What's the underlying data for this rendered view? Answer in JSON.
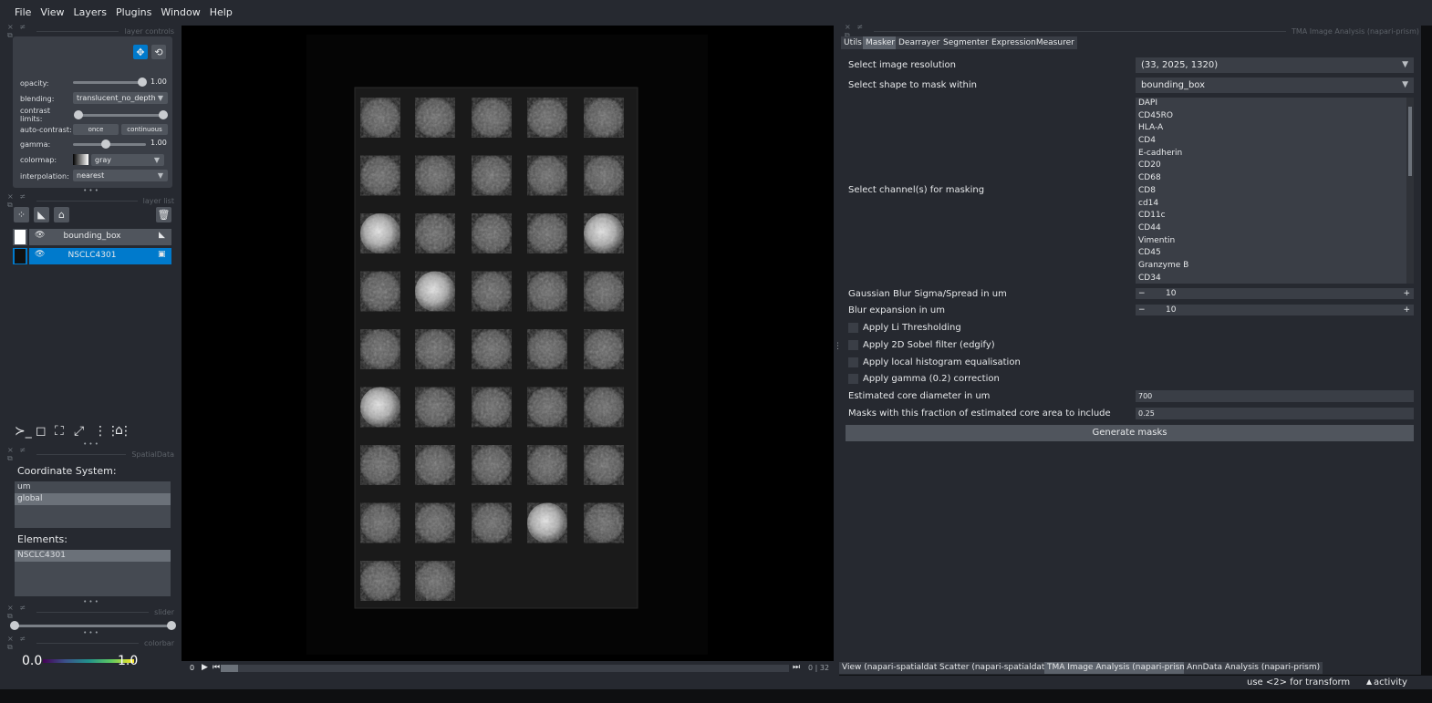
{
  "menu": [
    "File",
    "View",
    "Layers",
    "Plugins",
    "Window",
    "Help"
  ],
  "dock_titles": {
    "layer_controls": "layer controls",
    "layer_list": "layer list",
    "spatialdata": "SpatialData",
    "slider": "slider",
    "colorbar": "colorbar",
    "right": "TMA Image Analysis (napari-prism)"
  },
  "dock_controls": "× ≠ ⧉",
  "layer_controls": {
    "opacity_label": "opacity:",
    "opacity_value": "1.00",
    "opacity_level": 1.0,
    "blending_label": "blending:",
    "blending_value": "translucent_no_depth",
    "contrast_label": "contrast limits:",
    "autocontrast_label": "auto-contrast:",
    "once_label": "once",
    "continuous_label": "continuous",
    "gamma_label": "gamma:",
    "gamma_value": "1.00",
    "gamma_level": 0.45,
    "colormap_label": "colormap:",
    "colormap_value": "gray",
    "interpolation_label": "interpolation:",
    "interpolation_value": "nearest"
  },
  "more_dots": "• • •",
  "layers": [
    {
      "name": "bounding_box",
      "type": "shapes",
      "selected": false
    },
    {
      "name": "NSCLC4301",
      "type": "image",
      "selected": true
    }
  ],
  "spatialdata": {
    "coord_label": "Coordinate System:",
    "coords": [
      "um",
      "global"
    ],
    "coord_selected": 1,
    "elements_label": "Elements:",
    "elements": [
      "NSCLC4301"
    ]
  },
  "colorbar": {
    "min": "0.0",
    "max": "1.0"
  },
  "dims": {
    "current": "0",
    "range": "0 | 32"
  },
  "tabs": [
    "Utils",
    "Masker",
    "Dearrayer",
    "Segmenter",
    "ExpressionMeasurer"
  ],
  "tab_selected": 1,
  "masker": {
    "resolution_label": "Select image resolution",
    "resolution_value": "(33, 2025, 1320)",
    "shape_label": "Select shape to mask within",
    "shape_value": "bounding_box",
    "channels_label": "Select channel(s) for masking",
    "channels": [
      "DAPI",
      "CD45RO",
      "HLA-A",
      "CD4",
      "E-cadherin",
      "CD20",
      "CD68",
      "CD8",
      "cd14",
      "CD11c",
      "CD44",
      "Vimentin",
      "CD45",
      "Granzyme B",
      "CD34"
    ],
    "sigma_label": "Gaussian Blur Sigma/Spread in um",
    "sigma_value": "10",
    "blur_label": "Blur expansion in um",
    "blur_value": "10",
    "chk_li": "Apply Li Thresholding",
    "chk_sobel": "Apply 2D Sobel filter (edgify)",
    "chk_hist": "Apply local histogram equalisation",
    "chk_gamma": "Apply gamma (0.2) correction",
    "diameter_label": "Estimated core diameter in um",
    "diameter_value": "700",
    "fraction_label": "Masks with this fraction of estimated core area to include",
    "fraction_value": "0.25",
    "generate_label": "Generate masks"
  },
  "bottom_tabs": [
    "View (napari-spatialdata)",
    "Scatter (napari-spatialdata)",
    "TMA Image Analysis (napari-prism)",
    "AnnData Analysis (napari-prism)"
  ],
  "bottom_tab_selected": 2,
  "status": {
    "hint": "use <2> for transform",
    "activity": "activity"
  },
  "colors": {
    "accent": "#007acc",
    "panel": "#262930",
    "widget": "#3a3e46"
  }
}
